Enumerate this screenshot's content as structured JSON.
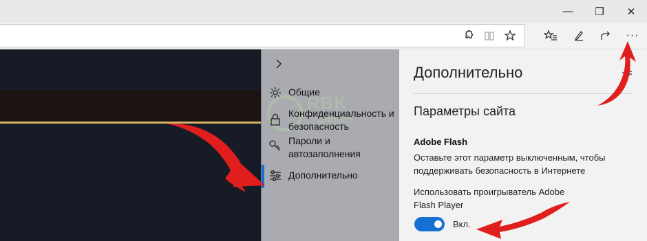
{
  "window": {
    "minimize_glyph": "—",
    "maximize_glyph": "❐",
    "close_glyph": "✕"
  },
  "toolbar": {
    "icons": [
      "extension-icon",
      "reading-view-icon",
      "favorite-star-icon",
      "favorites-hub-icon",
      "pen-icon",
      "share-icon",
      "more-icon"
    ],
    "more_glyph": "···"
  },
  "settings_nav": {
    "items": [
      {
        "label": "Общие",
        "icon": "gear-icon"
      },
      {
        "label": "Конфиденциальность и безопасность",
        "icon": "lock-icon"
      },
      {
        "label": "Пароли и автозаполнения",
        "icon": "key-icon"
      },
      {
        "label": "Дополнительно",
        "icon": "sliders-icon",
        "active": true
      }
    ],
    "watermark": {
      "line1": "RBK",
      "line2": "games"
    }
  },
  "settings_detail": {
    "title": "Дополнительно",
    "section_title": "Параметры сайта",
    "flash_title": "Adobe Flash",
    "flash_description": "Оставьте этот параметр выключенным, чтобы поддерживать безопасность в Интернете",
    "player_label": "Использовать проигрыватель Adobe Flash Player",
    "toggle": {
      "state": "on",
      "label": "Вкл."
    }
  },
  "colors": {
    "accent": "#1670d4",
    "annotation_red": "#e01e1e",
    "page_stripe": "#d7b46a"
  }
}
